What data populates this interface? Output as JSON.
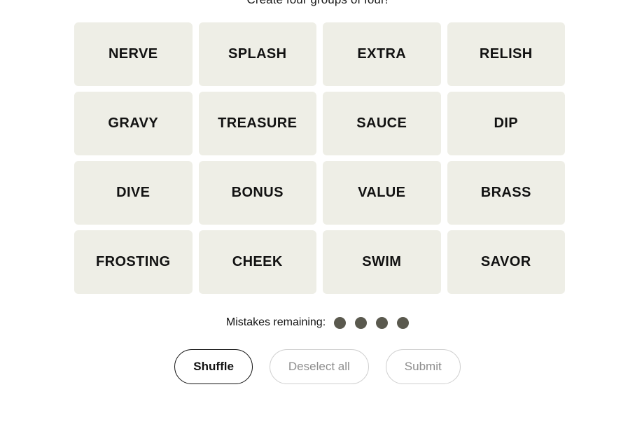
{
  "colors": {
    "page_background": "#ffffff",
    "tile_background": "#eeeee6",
    "tile_text": "#121212",
    "mistake_dot": "#5a594e",
    "enabled_border": "#121212",
    "disabled_border": "#cfcfcf",
    "disabled_text": "#8e8e8e"
  },
  "header": {
    "subtitle": "Create four groups of four!"
  },
  "board": {
    "rows": 4,
    "columns": 4,
    "tiles": [
      {
        "label": "NERVE",
        "selected": false
      },
      {
        "label": "SPLASH",
        "selected": false
      },
      {
        "label": "EXTRA",
        "selected": false
      },
      {
        "label": "RELISH",
        "selected": false
      },
      {
        "label": "GRAVY",
        "selected": false
      },
      {
        "label": "TREASURE",
        "selected": false
      },
      {
        "label": "SAUCE",
        "selected": false
      },
      {
        "label": "DIP",
        "selected": false
      },
      {
        "label": "DIVE",
        "selected": false
      },
      {
        "label": "BONUS",
        "selected": false
      },
      {
        "label": "VALUE",
        "selected": false
      },
      {
        "label": "BRASS",
        "selected": false
      },
      {
        "label": "FROSTING",
        "selected": false
      },
      {
        "label": "CHEEK",
        "selected": false
      },
      {
        "label": "SWIM",
        "selected": false
      },
      {
        "label": "SAVOR",
        "selected": false
      }
    ]
  },
  "mistakes": {
    "label": "Mistakes remaining:",
    "remaining": 4,
    "dots": [
      "dot",
      "dot",
      "dot",
      "dot"
    ]
  },
  "actions": {
    "shuffle": {
      "label": "Shuffle",
      "enabled": true
    },
    "deselect_all": {
      "label": "Deselect all",
      "enabled": false
    },
    "submit": {
      "label": "Submit",
      "enabled": false
    }
  }
}
